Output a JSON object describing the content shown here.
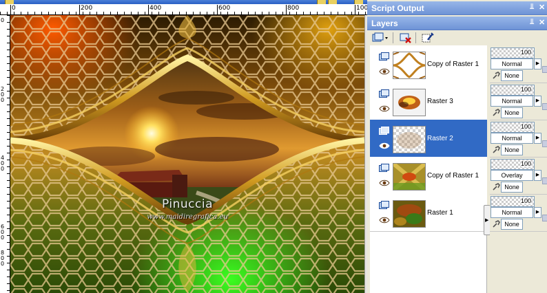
{
  "ruler": {
    "h_ticks": [
      "0",
      "200",
      "400",
      "600",
      "800",
      "100"
    ],
    "v_ticks": [
      "0",
      "2",
      "0",
      "0",
      "4",
      "0",
      "0",
      "6",
      "0",
      "0",
      "8",
      "0",
      "0"
    ]
  },
  "watermark": {
    "title": "Pinuccia",
    "url": "www.maidiregrafica.eu"
  },
  "panels": {
    "script_output_title": "Script Output",
    "layers_title": "Layers"
  },
  "layers": [
    {
      "name": "Copy of Raster 1",
      "opacity": "100",
      "blend": "Normal",
      "mask": "None",
      "selected": false
    },
    {
      "name": "Raster 3",
      "opacity": "100",
      "blend": "Normal",
      "mask": "None",
      "selected": false
    },
    {
      "name": "Raster 2",
      "opacity": "100",
      "blend": "Normal",
      "mask": "None",
      "selected": true
    },
    {
      "name": "Copy of Raster 1",
      "opacity": "100",
      "blend": "Overlay",
      "mask": "None",
      "selected": false
    },
    {
      "name": "Raster 1",
      "opacity": "100",
      "blend": "Normal",
      "mask": "None",
      "selected": false
    }
  ],
  "icons": {
    "pin": "pin-icon",
    "close": "close-icon",
    "new_layer": "new-layer-icon",
    "delete_layer": "delete-layer-icon",
    "properties": "layer-properties-icon",
    "visibility": "eye-icon",
    "link": "link-icon"
  },
  "colors": {
    "selected_row": "#316ac5",
    "panel_title": "#6e93d6"
  }
}
